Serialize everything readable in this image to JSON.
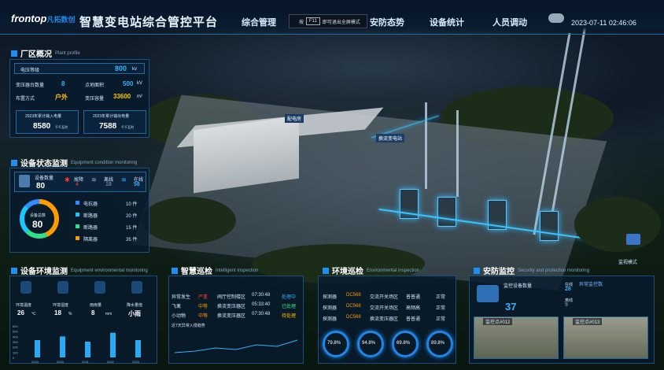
{
  "header": {
    "logo": "frontop",
    "logo_cn": "凡拓数创",
    "title": "智慧变电站综合管控平台",
    "nav": [
      "综合管理",
      "安防态势",
      "设备统计",
      "人员调动"
    ],
    "fullscreen_tip_pre": "按",
    "fullscreen_key": "F11",
    "fullscreen_tip_post": "即可退出全屏模式",
    "datetime": "2023-07-11  02:46:06"
  },
  "plant": {
    "title": "厂区概况",
    "title_en": "Plant profile",
    "voltage_label": "电压等级",
    "voltage_value": "800",
    "voltage_unit": "kv",
    "transformers_label": "变压器台数量",
    "transformers_value": "8",
    "volt2_label": "点地面积",
    "volt2_value": "500",
    "volt2_unit": "kV",
    "layout_label": "布置方式",
    "layout_value": "户外",
    "capacity_label": "变压容量",
    "capacity_value": "33600",
    "capacity_unit": "m²",
    "input_label": "2023年累计输入电量",
    "input_value": "8580",
    "input_unit": "千千瓦时",
    "output_label": "2023年累计输出电量",
    "output_value": "7588",
    "output_unit": "千千瓦时"
  },
  "equipment_status": {
    "title": "设备状态监测",
    "title_en": "Equipment condition monitoring",
    "count_label": "设备数量",
    "count_value": "80",
    "s1_label": "故障",
    "s1_value": "4",
    "s2_label": "离线",
    "s2_value": "18",
    "s3_label": "在线",
    "s3_value": "58",
    "total_label": "设备总数",
    "total_value": "80",
    "legend": [
      {
        "name": "电抗器",
        "value": "10 件",
        "color": "#2f8dff"
      },
      {
        "name": "断路器",
        "value": "20 件",
        "color": "#18c9ff"
      },
      {
        "name": "断路器",
        "value": "15 件",
        "color": "#2fe18a"
      },
      {
        "name": "隔离器",
        "value": "35 件",
        "color": "#ff9a00"
      }
    ]
  },
  "env": {
    "title": "设备环境监测",
    "title_en": "Equipment environmental monitoring",
    "items": [
      {
        "label": "环境温度",
        "value": "26",
        "unit": "℃"
      },
      {
        "label": "环境湿度",
        "value": "18",
        "unit": "%"
      },
      {
        "label": "雨雨量",
        "value": "8",
        "unit": "mm"
      },
      {
        "label": "降水量值",
        "value": "小雨",
        "unit": ""
      }
    ],
    "chart_years": [
      "2019",
      "2020",
      "2021",
      "2022",
      "2023"
    ],
    "chart_ticks": [
      "600",
      "500",
      "400",
      "300",
      "200",
      "100",
      "0"
    ]
  },
  "chart_data": {
    "type": "bar",
    "categories": [
      "2019",
      "2020",
      "2021",
      "2022",
      "2023"
    ],
    "values": [
      330,
      400,
      300,
      470,
      330
    ],
    "ylim": [
      0,
      600
    ]
  },
  "patrol": {
    "title": "智慧巡检",
    "title_en": "Intelligent inspection",
    "rows": [
      [
        "异常发生",
        "严重",
        "阀厅控制楼区",
        "07:30:48",
        "处理中"
      ],
      [
        "飞禽",
        "中等",
        "换流变压器区",
        "05:33:40",
        "已处理"
      ],
      [
        "小动物",
        "中等",
        "换流变压器区",
        "07:30:48",
        "待处理"
      ]
    ],
    "chart_title": "近7天异常入侵趋势"
  },
  "envpatrol": {
    "title": "环境巡检",
    "title_en": "Environmental inspection",
    "rows": [
      [
        "探测器",
        "DC568",
        "交流开关场区",
        "普普通",
        "正常"
      ],
      [
        "探测器",
        "DC568",
        "交流开关场区",
        "高频高",
        "正常"
      ],
      [
        "探测器",
        "DC568",
        "换流变压器区",
        "普普通",
        "正常"
      ]
    ],
    "rings": [
      "79.8%",
      "94.8%",
      "69.8%",
      "89.8%"
    ]
  },
  "security": {
    "title": "安防监控",
    "title_en": "Security and protection monitoring",
    "count_label": "监控设备数量",
    "count_value": "37",
    "online_label": "在线",
    "online_value": "28",
    "offline_label": "离线",
    "offline_value": "9",
    "abnormal_label": "异常监控数",
    "cams": [
      "监控点#012",
      "监控点#013"
    ]
  },
  "scene": {
    "label_main": "配电房",
    "label_sub": "换流变电站",
    "side_btn": "监视模式"
  }
}
